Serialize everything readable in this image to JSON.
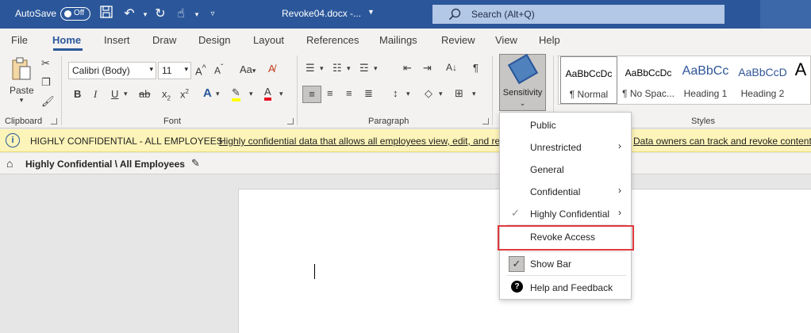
{
  "titlebar": {
    "autosave_label": "AutoSave",
    "toggle_text": "Off",
    "doc_name": "Revoke04.docx  -...",
    "search_text": "Search (Alt+Q)"
  },
  "menu": {
    "tabs": [
      "File",
      "Home",
      "Insert",
      "Draw",
      "Design",
      "Layout",
      "References",
      "Mailings",
      "Review",
      "View",
      "Help"
    ],
    "active": "Home"
  },
  "ribbon": {
    "paste_label": "Paste",
    "font_name": "Calibri (Body)",
    "font_size": "11",
    "sensitivity_label": "Sensitivity",
    "groups": {
      "clipboard": "Clipboard",
      "font": "Font",
      "paragraph": "Paragraph",
      "styles": "Styles"
    },
    "styles": [
      {
        "preview": "AaBbCcDc",
        "name": "¶ Normal"
      },
      {
        "preview": "AaBbCcDc",
        "name": "¶ No Spac..."
      },
      {
        "preview": "AaBbCc",
        "name": "Heading 1"
      },
      {
        "preview": "AaBbCcD",
        "name": "Heading 2"
      },
      {
        "preview": "A",
        "name": ""
      }
    ]
  },
  "infobar": {
    "label": "HIGHLY CONFIDENTIAL - ALL EMPLOYEES",
    "link_text": "Highly confidential data that allows all employees view, edit, and re",
    "link_text_end": "Data owners can track and revoke content."
  },
  "labelbar": {
    "label": "Highly Confidential \\ All Employees"
  },
  "dropdown": {
    "items": {
      "public": "Public",
      "unrestricted": "Unrestricted",
      "general": "General",
      "confidential": "Confidential",
      "highly_confidential": "Highly Confidential",
      "revoke": "Revoke Access",
      "show_bar": "Show Bar",
      "help": "Help and Feedback"
    }
  },
  "colors": {
    "titlebar": "#2b579a",
    "infobar": "#fcf4b8",
    "highlight_border": "#e0393e"
  }
}
